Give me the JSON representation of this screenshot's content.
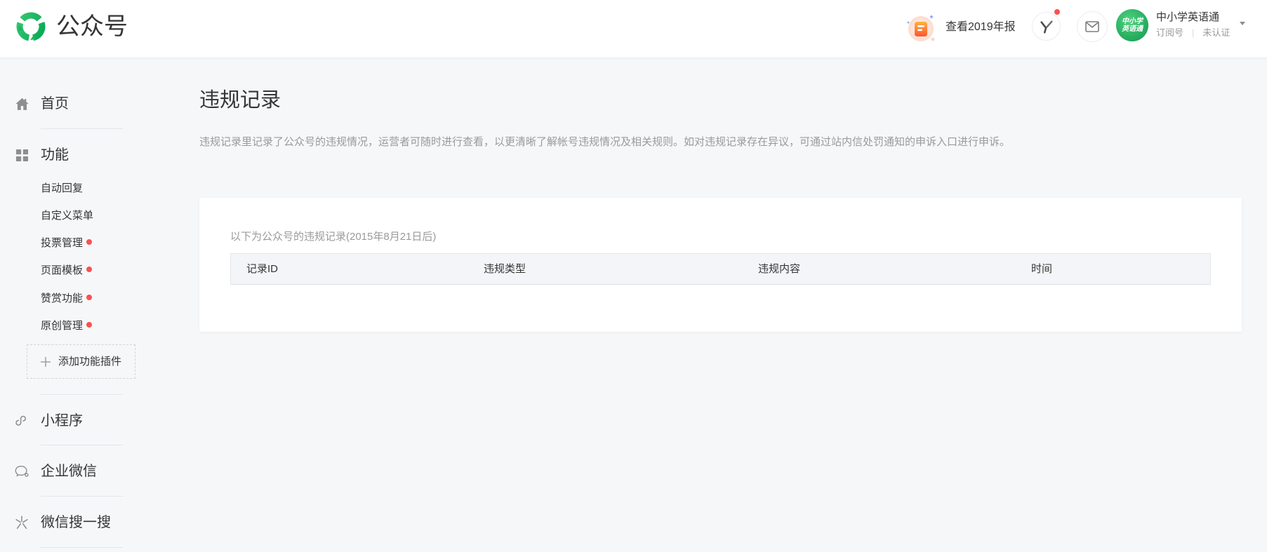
{
  "header": {
    "logo_text": "公众号",
    "logo_icon": "official-accounts-logo",
    "report_link": "查看2019年报",
    "report_icon": "annual-report-icon",
    "assistant_icon": "y-icon",
    "assistant_badge": true,
    "mail_icon": "mail-icon",
    "account": {
      "avatar_line1": "中小学",
      "avatar_line2": "英语通",
      "name": "中小学英语通",
      "type": "订阅号",
      "separator": "|",
      "verify_status": "未认证",
      "menu_icon": "chevron-down-icon"
    }
  },
  "sidebar": {
    "home": {
      "label": "首页",
      "icon": "home-icon"
    },
    "features": {
      "label": "功能",
      "icon": "grid-icon",
      "items": [
        {
          "label": "自动回复",
          "badge": false
        },
        {
          "label": "自定义菜单",
          "badge": false
        },
        {
          "label": "投票管理",
          "badge": true
        },
        {
          "label": "页面模板",
          "badge": true
        },
        {
          "label": "赞赏功能",
          "badge": true
        },
        {
          "label": "原创管理",
          "badge": true
        }
      ],
      "add_plugin": "添加功能插件",
      "add_icon": "plus-icon"
    },
    "mini_program": {
      "label": "小程序",
      "icon": "mini-program-icon"
    },
    "work_wechat": {
      "label": "企业微信",
      "icon": "work-wechat-icon"
    },
    "search": {
      "label": "微信搜一搜",
      "icon": "search-sparkle-icon"
    }
  },
  "main": {
    "title": "违规记录",
    "description": "违规记录里记录了公众号的违规情况，运营者可随时进行查看，以更清晰了解帐号违规情况及相关规则。如对违规记录存在异议，可通过站内信处罚通知的申诉入口进行申诉。",
    "records": {
      "intro": "以下为公众号的违规记录(2015年8月21日后)",
      "columns": [
        "记录ID",
        "违规类型",
        "违规内容",
        "时间"
      ]
    }
  },
  "colors": {
    "brand_green": "#07c160",
    "badge_red": "#fa5151",
    "page_background": "#f6f7f9",
    "muted_text": "#9a9a9a"
  }
}
